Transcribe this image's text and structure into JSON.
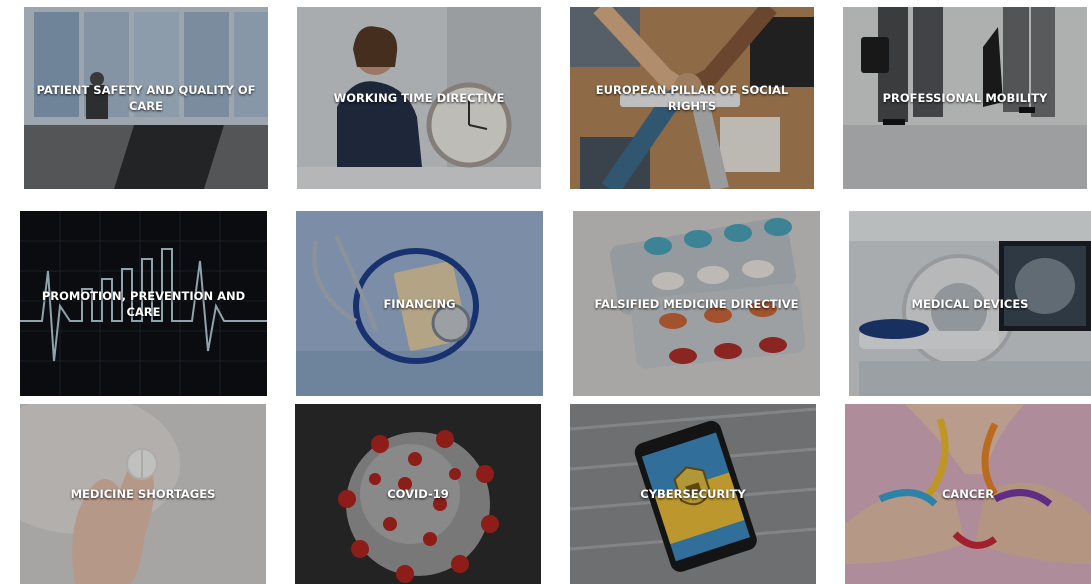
{
  "tiles": [
    {
      "label": "PATIENT SAFETY AND QUALITY OF CARE",
      "icon": "wheelchair-window-photo"
    },
    {
      "label": "WORKING TIME DIRECTIVE",
      "icon": "woman-clock-photo"
    },
    {
      "label": "EUROPEAN PILLAR OF SOCIAL RIGHTS",
      "icon": "team-fist-bump-photo"
    },
    {
      "label": "PROFESSIONAL MOBILITY",
      "icon": "walking-professionals-photo"
    },
    {
      "label": "PROMOTION, PREVENTION AND CARE",
      "icon": "heartbeat-chart-photo"
    },
    {
      "label": "FINANCING",
      "icon": "stethoscope-money-photo"
    },
    {
      "label": "FALSIFIED MEDICINE DIRECTIVE",
      "icon": "pill-blisters-photo"
    },
    {
      "label": "MEDICAL DEVICES",
      "icon": "ct-scanner-photo"
    },
    {
      "label": "MEDICINE SHORTAGES",
      "icon": "hand-pill-photo"
    },
    {
      "label": "COVID-19",
      "icon": "virus-photo"
    },
    {
      "label": "CYBERSECURITY",
      "icon": "phone-lock-photo"
    },
    {
      "label": "CANCER",
      "icon": "awareness-ribbons-photo"
    }
  ]
}
